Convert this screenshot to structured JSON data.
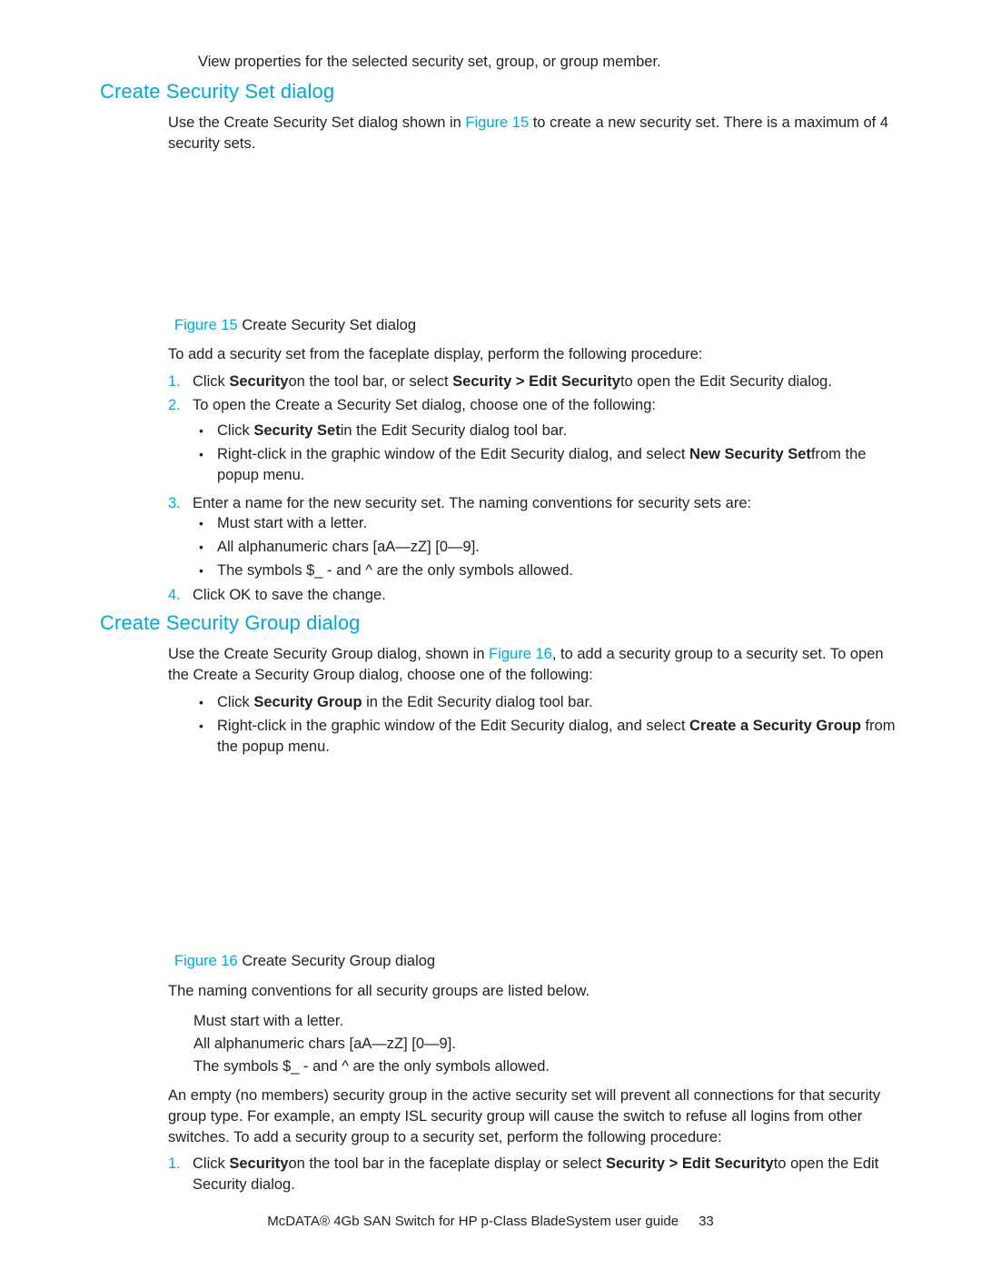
{
  "colors": {
    "heading": "#00a8e1",
    "link": "#00a8e1",
    "body_text": "#231f20",
    "list_number": "#00a8e1",
    "page_background": "#ffffff"
  },
  "intro": {
    "line": "View properties for the selected security set, group, or group member."
  },
  "section_1": {
    "heading": "Create Security Set dialog",
    "intro_para": {
      "before_link": "Use the Create Security Set dialog shown in ",
      "link": "Figure 15",
      "after_link": " to create a new security set. There is a maximum of 4 security sets."
    },
    "figure": {
      "label": "Figure 15",
      "title": "Create Security Set dialog"
    },
    "procedure_lead": "To add a security set from the faceplate display, perform the following procedure:",
    "steps": [
      {
        "number": "1.",
        "parts": [
          {
            "text": "Click ",
            "bold": false
          },
          {
            "text": "Security",
            "bold": true
          },
          {
            "text": "on the tool bar, or select ",
            "bold": false
          },
          {
            "text": "Security > Edit Security",
            "bold": true
          },
          {
            "text": "to open the Edit Security dialog.",
            "bold": false
          }
        ]
      },
      {
        "number": "2.",
        "parts": [
          {
            "text": "To open the Create a Security Set dialog, choose one of the following:",
            "bold": false
          }
        ]
      }
    ],
    "step2_bullets": [
      {
        "parts": [
          {
            "text": "Click ",
            "bold": false
          },
          {
            "text": "Security Set",
            "bold": true
          },
          {
            "text": "in the Edit Security dialog tool bar.",
            "bold": false
          }
        ]
      },
      {
        "parts": [
          {
            "text": "Right-click in the graphic window of the Edit Security dialog, and select ",
            "bold": false
          },
          {
            "text": "New Security Set",
            "bold": true
          },
          {
            "text": "from the popup menu.",
            "bold": false
          }
        ]
      }
    ],
    "step3": {
      "number": "3.",
      "text": "Enter a name for the new security set. The naming conventions for security sets are:"
    },
    "step3_bullets": [
      "Must start with a letter.",
      "All alphanumeric chars [aA—zZ] [0—9].",
      "The symbols $_ - and ^ are the only symbols allowed."
    ],
    "step4": {
      "number": "4.",
      "text": "Click OK to save the change."
    }
  },
  "section_2": {
    "heading": "Create Security Group dialog",
    "intro_para": {
      "before_link": "Use the Create Security Group dialog, shown in ",
      "link": "Figure 16",
      "after_link": ", to add a security group to a security set. To open the Create a Security Group dialog, choose one of the following:"
    },
    "bullets": [
      {
        "parts": [
          {
            "text": "Click ",
            "bold": false
          },
          {
            "text": "Security Group",
            "bold": true
          },
          {
            "text": " in the Edit Security dialog tool bar.",
            "bold": false
          }
        ]
      },
      {
        "parts": [
          {
            "text": "Right-click in the graphic window of the Edit Security dialog, and select ",
            "bold": false
          },
          {
            "text": "Create a Security Group",
            "bold": true
          },
          {
            "text": " from the popup menu.",
            "bold": false
          }
        ]
      }
    ],
    "figure": {
      "label": "Figure 16",
      "title": "Create Security Group dialog"
    },
    "conventions_lead": "The naming conventions for all security groups are listed below.",
    "conventions": [
      "Must start with a letter.",
      "All alphanumeric chars [aA—zZ] [0—9].",
      "The symbols $_ - and ^ are the only symbols allowed."
    ],
    "empty_group_para": "An empty (no members) security group in the active security set will prevent all connections for that security group type. For example, an empty ISL security group will cause the switch to refuse all logins from other switches. To add a security group to a security set, perform the following procedure:",
    "steps": [
      {
        "number": "1.",
        "parts": [
          {
            "text": "Click ",
            "bold": false
          },
          {
            "text": "Security",
            "bold": true
          },
          {
            "text": "on the tool bar in the faceplate display or select ",
            "bold": false
          },
          {
            "text": "Security > Edit Security",
            "bold": true
          },
          {
            "text": "to open the Edit Security dialog.",
            "bold": false
          }
        ]
      }
    ]
  },
  "footer": {
    "title": "McDATA® 4Gb SAN Switch for HP p-Class BladeSystem user guide",
    "page_number": "33"
  }
}
